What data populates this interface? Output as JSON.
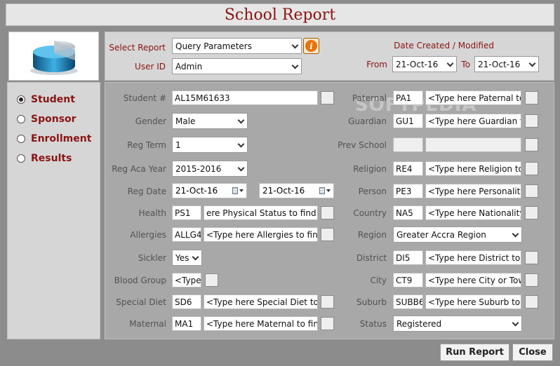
{
  "window": {
    "title": "School Report"
  },
  "logo": {
    "icon": "pie-chart-icon"
  },
  "categories": [
    {
      "label": "Student",
      "selected": true
    },
    {
      "label": "Sponsor",
      "selected": false
    },
    {
      "label": "Enrollment",
      "selected": false
    },
    {
      "label": "Results",
      "selected": false
    }
  ],
  "params": {
    "select_report_label": "Select Report",
    "select_report_value": "Query Parameters",
    "user_id_label": "User ID",
    "user_id_value": "Admin",
    "date_header": "Date Created / Modified",
    "from_label": "From",
    "from_value": "21-Oct-16",
    "to_label": "To",
    "to_value": "21-Oct-16"
  },
  "left_fields": {
    "student_label": "Student #",
    "student_value": "AL15M61633",
    "gender_label": "Gender",
    "gender_value": "Male",
    "reg_term_label": "Reg Term",
    "reg_term_value": "1",
    "reg_aca_year_label": "Reg Aca Year",
    "reg_aca_year_value": "2015-2016",
    "reg_date_label": "Reg Date",
    "reg_date_from": "21-Oct-16",
    "reg_date_to": "21-Oct-16",
    "health_label": "Health",
    "health_code": "PS1",
    "health_value": "ere Physical Status to find>",
    "allergies_label": "Allergies",
    "allergies_code": "ALLG4",
    "allergies_value": "<Type here Allergies to find",
    "sickler_label": "Sickler",
    "sickler_value": "Yes",
    "blood_group_label": "Blood Group",
    "blood_group_value": "<Type",
    "special_diet_label": "Special Diet",
    "special_diet_code": "SD6",
    "special_diet_value": "<Type here Special Diet to",
    "maternal_label": "Maternal",
    "maternal_code": "MA1",
    "maternal_value": "<Type here Maternal to find"
  },
  "right_fields": {
    "paternal_label": "Paternal",
    "paternal_code": "PA1",
    "paternal_value": "<Type here Paternal to",
    "guardian_label": "Guardian",
    "guardian_code": "GU1",
    "guardian_value": "<Type here Guardian to",
    "prev_school_label": "Prev School",
    "religion_label": "Religion",
    "religion_code": "RE4",
    "religion_value": "<Type here Religion to",
    "person_label": "Person",
    "person_code": "PE3",
    "person_value": "<Type here Personality",
    "country_label": "Country",
    "country_code": "NA5",
    "country_value": "<Type here Nationality",
    "region_label": "Region",
    "region_value": "Greater Accra Region",
    "district_label": "District",
    "district_code": "DI5",
    "district_value": "<Type here District to f",
    "city_label": "City",
    "city_code": "CT9",
    "city_value": "<Type here City or Tow",
    "suburb_label": "Suburb",
    "suburb_code": "SUBB6",
    "suburb_value": "<Type here Suburb to f",
    "status_label": "Status",
    "status_value": "Registered"
  },
  "buttons": {
    "run_report": "Run Report",
    "close": "Close"
  },
  "watermark": "SOFTPEDIA",
  "colors": {
    "accent": "#8a1414",
    "background": "#8c8c8c",
    "info": "#e8730a"
  }
}
